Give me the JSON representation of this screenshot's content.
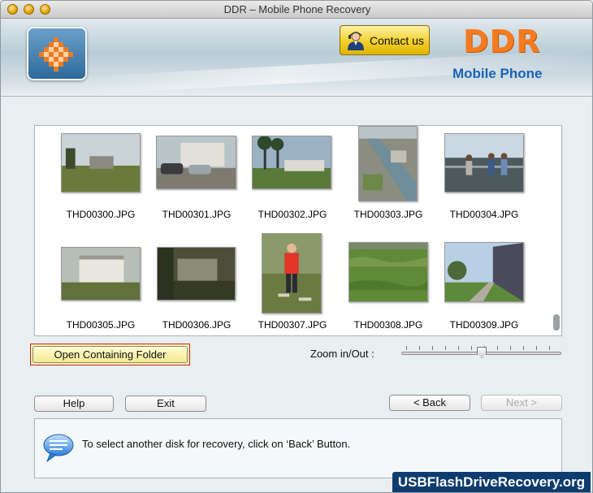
{
  "window": {
    "title": "DDR – Mobile Phone Recovery"
  },
  "header": {
    "contact_label": "Contact us",
    "brand": "DDR",
    "sub_brand": "Mobile Phone"
  },
  "gallery": {
    "items": [
      {
        "name": "THD00300.JPG",
        "icon": "photo-building-lawn"
      },
      {
        "name": "THD00301.JPG",
        "icon": "photo-cars-house"
      },
      {
        "name": "THD00302.JPG",
        "icon": "photo-palm-street"
      },
      {
        "name": "THD00303.JPG",
        "icon": "photo-aerial-river"
      },
      {
        "name": "THD00304.JPG",
        "icon": "photo-people-railing"
      },
      {
        "name": "THD00305.JPG",
        "icon": "photo-white-mansion"
      },
      {
        "name": "THD00306.JPG",
        "icon": "photo-mansion-dusk"
      },
      {
        "name": "THD00307.JPG",
        "icon": "photo-man-red-shirt"
      },
      {
        "name": "THD00308.JPG",
        "icon": "photo-grass-field"
      },
      {
        "name": "THD00309.JPG",
        "icon": "photo-street-buildings"
      }
    ]
  },
  "controls": {
    "open_folder_label": "Open Containing Folder",
    "zoom_label": "Zoom in/Out :",
    "zoom_level": 0.5
  },
  "buttons": {
    "help": "Help",
    "exit": "Exit",
    "back": "< Back",
    "next": "Next >"
  },
  "status": {
    "message": "To select another disk for recovery, click on ‘Back’ Button.",
    "icon": "speech-bubble-icon"
  },
  "watermark": "USBFlashDriveRecovery.org",
  "colors": {
    "brand_orange": "#f47b20",
    "brand_blue": "#1c63b7",
    "watermark_bg": "#0e3c6e",
    "highlight_border": "#cc2222"
  }
}
